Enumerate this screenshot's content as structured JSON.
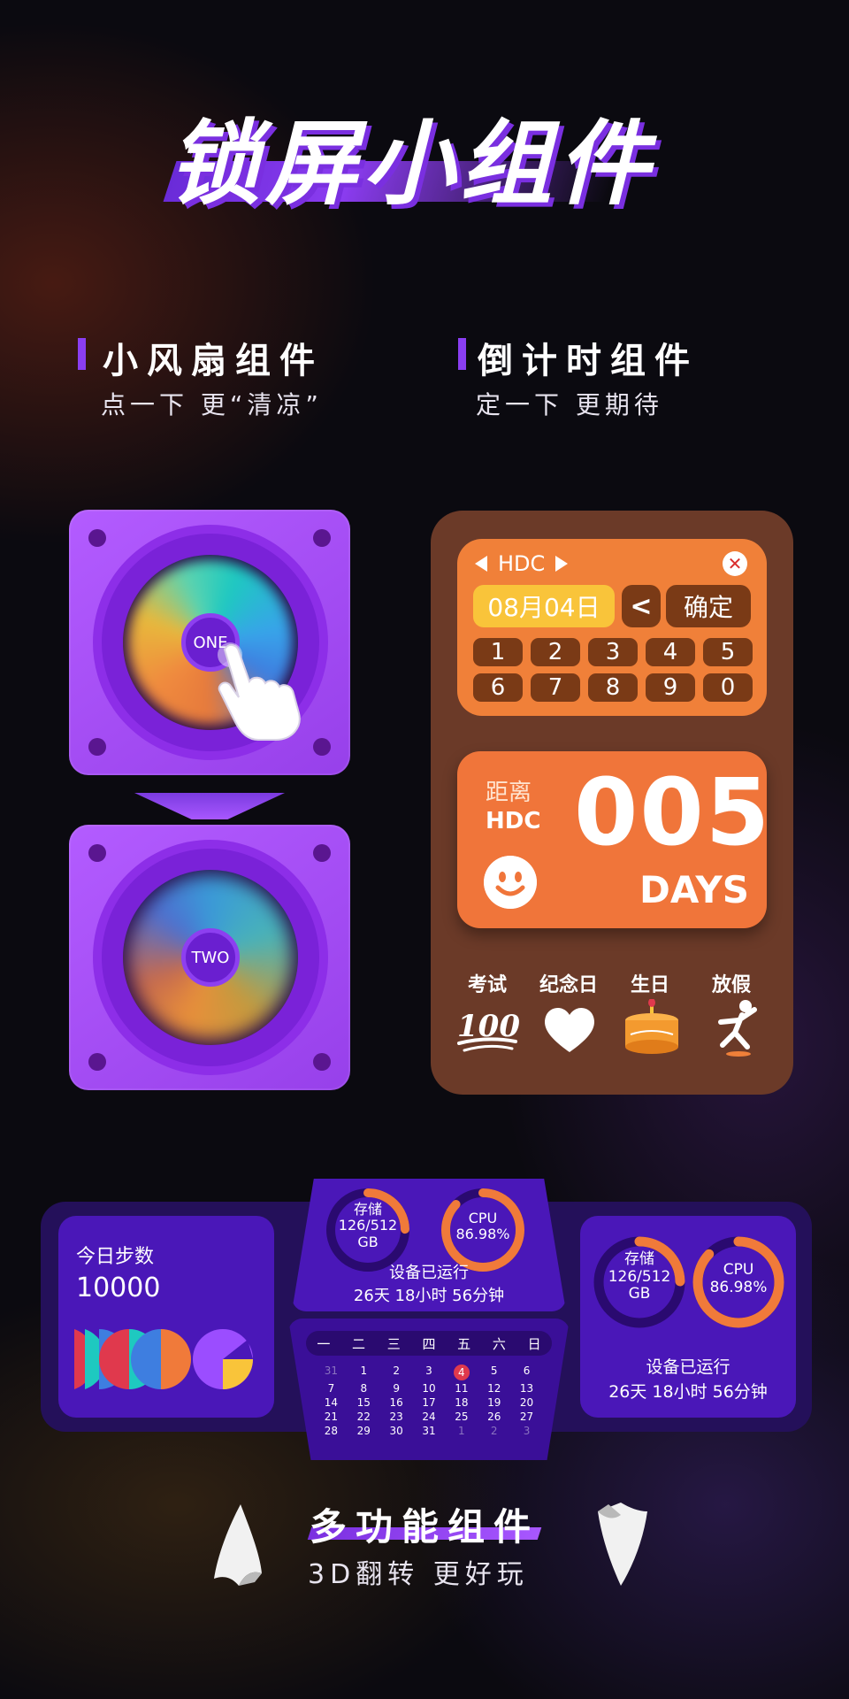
{
  "headline": {
    "title": "锁屏小组件"
  },
  "sections": {
    "fan": {
      "title": "小风扇组件",
      "subtitle": "点一下 更“清凉”"
    },
    "countdown": {
      "title": "倒计时组件",
      "subtitle": "定一下 更期待"
    },
    "multi": {
      "title": "多功能组件",
      "subtitle": "3D翻转 更好玩"
    }
  },
  "fan_widgets": [
    {
      "hub_label": "ONE"
    },
    {
      "hub_label": "TWO"
    }
  ],
  "countdown_editor": {
    "event_name": "HDC",
    "date_value": "08月04日",
    "backspace_label": "<",
    "confirm_label": "确定",
    "keys": [
      "1",
      "2",
      "3",
      "4",
      "5",
      "6",
      "7",
      "8",
      "9",
      "0"
    ]
  },
  "countdown_card": {
    "distance_label": "距离",
    "event_name": "HDC",
    "days_value": "005",
    "days_unit": "DAYS"
  },
  "categories": [
    {
      "label": "考试",
      "icon": "score-100-icon"
    },
    {
      "label": "纪念日",
      "icon": "heart-icon"
    },
    {
      "label": "生日",
      "icon": "birthday-cake-icon"
    },
    {
      "label": "放假",
      "icon": "jumping-person-icon"
    }
  ],
  "steps_widget": {
    "label": "今日步数",
    "value": "10000"
  },
  "system_widget": {
    "storage_label": "存储",
    "storage_value": "126/512",
    "storage_unit": "GB",
    "storage_fraction": 0.246,
    "cpu_label": "CPU",
    "cpu_value": "86.98%",
    "cpu_fraction": 0.8698,
    "uptime_label": "设备已运行",
    "uptime_value": "26天 18小时 56分钟"
  },
  "calendar": {
    "weekdays": [
      "一",
      "二",
      "三",
      "四",
      "五",
      "六",
      "日"
    ],
    "days": [
      "31",
      "1",
      "2",
      "3",
      "4",
      "5",
      "6",
      "7",
      "8",
      "9",
      "10",
      "11",
      "12",
      "13",
      "14",
      "15",
      "16",
      "17",
      "18",
      "19",
      "20",
      "21",
      "22",
      "23",
      "24",
      "25",
      "26",
      "27",
      "28",
      "29",
      "30",
      "31",
      "1",
      "2",
      "3"
    ],
    "today": "4"
  },
  "colors": {
    "accent_purple": "#8a3ef2",
    "countdown_orange": "#f08039",
    "ring_orange": "#f07a3a",
    "widget_purple": "#4a17b8"
  }
}
